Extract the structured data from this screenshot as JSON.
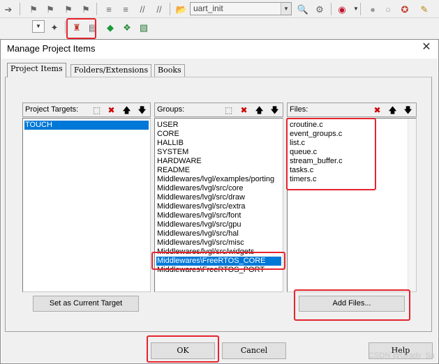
{
  "toolbar": {
    "target_combo_value": "uart_init"
  },
  "dialog": {
    "title": "Manage Project Items",
    "close_glyph": "✕",
    "tabs": [
      {
        "label": "Project Items",
        "active": true
      },
      {
        "label": "Folders/Extensions",
        "active": false
      },
      {
        "label": "Books",
        "active": false
      }
    ],
    "targets": {
      "header": "Project Targets:",
      "items": [
        "TOUCH"
      ],
      "selected": "TOUCH",
      "set_current_label": "Set as Current Target"
    },
    "groups": {
      "header": "Groups:",
      "items": [
        "USER",
        "CORE",
        "HALLIB",
        "SYSTEM",
        "HARDWARE",
        "README",
        "Middlewares/lvgl/examples/porting",
        "Middlewares/lvgl/src/core",
        "Middlewares/lvgl/src/draw",
        "Middlewares/lvgl/src/extra",
        "Middlewares/lvgl/src/font",
        "Middlewares/lvgl/src/gpu",
        "Middlewares/lvgl/src/hal",
        "Middlewares/lvgl/src/misc",
        "Middlewares/lvgl/src/widgets",
        "Middlewares\\FreeRTOS_CORE",
        "Middlewares\\FreeRTOS_PORT"
      ],
      "selected": "Middlewares\\FreeRTOS_CORE"
    },
    "files": {
      "header": "Files:",
      "items": [
        "croutine.c",
        "event_groups.c",
        "list.c",
        "queue.c",
        "stream_buffer.c",
        "tasks.c",
        "timers.c"
      ],
      "add_files_label": "Add Files..."
    },
    "footer": {
      "ok_label": "OK",
      "cancel_label": "Cancel",
      "help_label": "Help"
    }
  },
  "watermark": "CSDN @Grady_Sa",
  "colors": {
    "selection": "#0078d7",
    "highlight_box": "#e5232d"
  }
}
